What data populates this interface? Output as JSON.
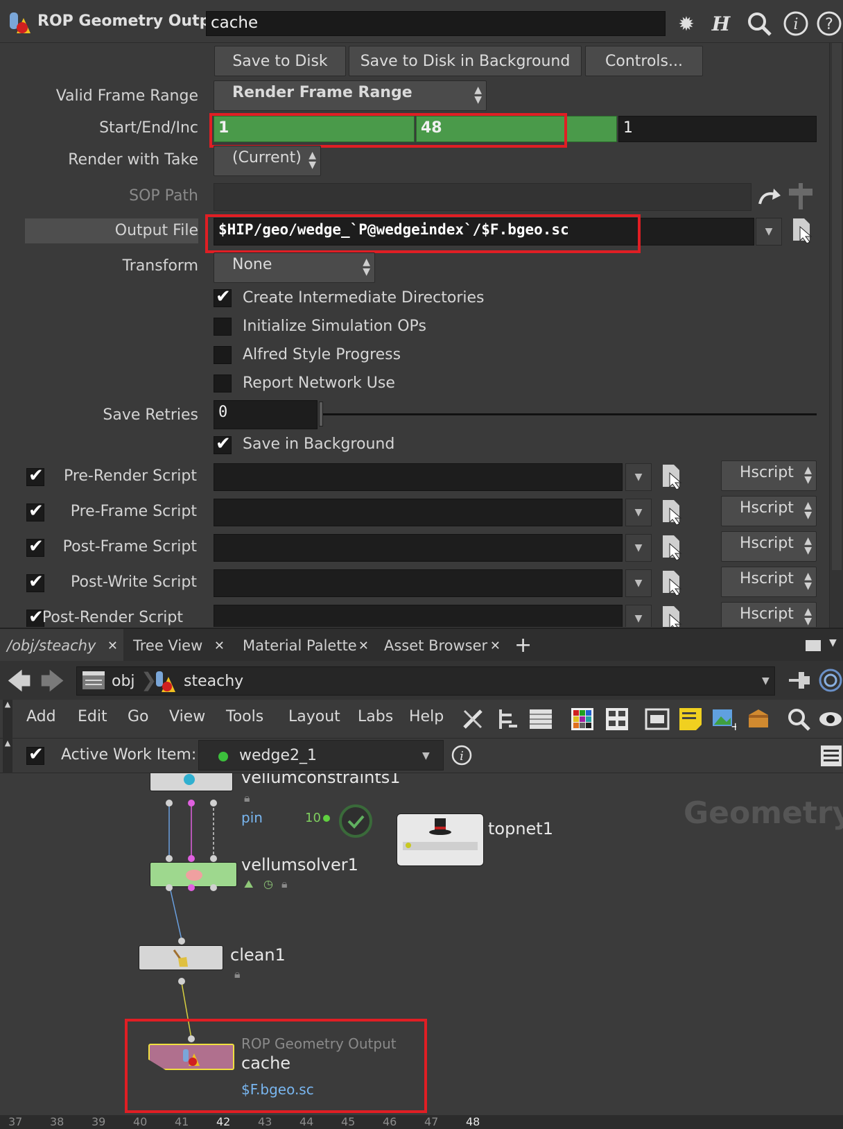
{
  "param_pane": {
    "node_type": "ROP Geometry Output",
    "node_name": "cache",
    "buttons": {
      "save_to_disk": "Save to Disk",
      "save_to_disk_bg": "Save to Disk in Background",
      "controls": "Controls..."
    },
    "valid_frame_range": {
      "label": "Valid Frame Range",
      "value": "Render Frame Range"
    },
    "start_end_inc": {
      "label": "Start/End/Inc",
      "start": "1",
      "end": "48",
      "inc": "1"
    },
    "render_with_take": {
      "label": "Render with Take",
      "value": "(Current)"
    },
    "sop_path": {
      "label": "SOP Path",
      "value": ""
    },
    "output_file": {
      "label": "Output File",
      "value": "$HIP/geo/wedge_`P@wedgeindex`/$F.bgeo.sc"
    },
    "transform": {
      "label": "Transform",
      "value": "None"
    },
    "checkboxes": [
      {
        "label": "Create Intermediate Directories",
        "checked": true
      },
      {
        "label": "Initialize Simulation OPs",
        "checked": false
      },
      {
        "label": "Alfred Style Progress",
        "checked": false
      },
      {
        "label": "Report Network Use",
        "checked": false
      }
    ],
    "save_retries": {
      "label": "Save Retries",
      "value": "0"
    },
    "save_in_background": {
      "label": "Save in Background",
      "checked": true
    },
    "scripts": [
      {
        "label": "Pre-Render Script",
        "lang": "Hscript",
        "checked": true
      },
      {
        "label": "Pre-Frame Script",
        "lang": "Hscript",
        "checked": true
      },
      {
        "label": "Post-Frame Script",
        "lang": "Hscript",
        "checked": true
      },
      {
        "label": "Post-Write Script",
        "lang": "Hscript",
        "checked": true
      },
      {
        "label": "Post-Render Script",
        "lang": "Hscript",
        "checked": true
      }
    ]
  },
  "network_pane": {
    "tabs": [
      "/obj/steachy",
      "Tree View",
      "Material Palette",
      "Asset Browser"
    ],
    "path": [
      "obj",
      "steachy"
    ],
    "menu": [
      "Add",
      "Edit",
      "Go",
      "View",
      "Tools",
      "Layout",
      "Labs",
      "Help"
    ],
    "active_work_item": {
      "label": "Active Work Item:",
      "value": "wedge2_1"
    },
    "context_label": "Geometry",
    "nodes": {
      "vellumconstraints": {
        "name": "vellumconstraints1",
        "sub": "pin"
      },
      "vellumsolver": {
        "name": "vellumsolver1"
      },
      "clean": {
        "name": "clean1"
      },
      "cache": {
        "type": "ROP Geometry Output",
        "name": "cache",
        "sub": "$F.bgeo.sc"
      },
      "topnet": {
        "name": "topnet1",
        "count": "10"
      }
    },
    "timeline_ticks": [
      "37",
      "38",
      "39",
      "40",
      "41",
      "42",
      "43",
      "44",
      "45",
      "46",
      "47",
      "48"
    ]
  },
  "colors": {
    "highlight_red": "#e01e24",
    "green_field": "#4a9a4a",
    "rop_node": "#b0708e",
    "solver_node": "#9ed88e",
    "link_blue": "#79b6f0"
  }
}
